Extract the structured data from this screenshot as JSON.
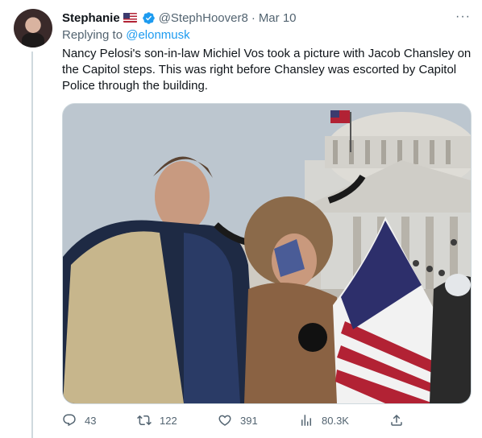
{
  "tweet": {
    "author_name": "Stephanie",
    "author_handle": "@StephHoover8",
    "separator": "·",
    "date": "Mar 10",
    "replying_prefix": "Replying to ",
    "replying_to": "@elonmusk",
    "text": "Nancy Pelosi's son-in-law Michiel Vos took a picture with Jacob Chansley on the Capitol steps. This was right before Chansley was escorted by Capitol Police through the building.",
    "more_glyph": "···"
  },
  "actions": {
    "replies": "43",
    "retweets": "122",
    "likes": "391",
    "views": "80.3K"
  },
  "colors": {
    "link_blue": "#1d9bf0",
    "secondary_text": "#536471",
    "border": "#cfd9de"
  }
}
